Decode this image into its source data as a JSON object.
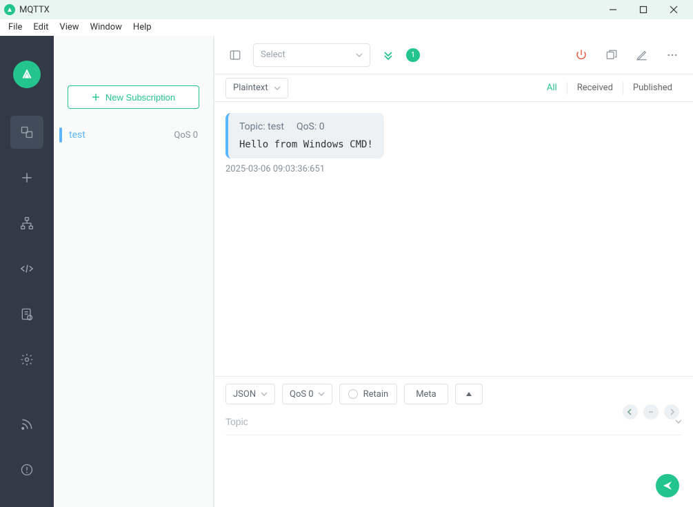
{
  "window": {
    "title": "MQTTX"
  },
  "menubar": {
    "file": "File",
    "edit": "Edit",
    "view": "View",
    "window": "Window",
    "help": "Help"
  },
  "sidebar": {
    "items": [
      "connections",
      "new",
      "tree",
      "code",
      "log",
      "settings",
      "feed",
      "info"
    ]
  },
  "subs": {
    "new_label": "New Subscription",
    "items": [
      {
        "name": "test",
        "qos": "QoS 0"
      }
    ]
  },
  "topbar": {
    "select_placeholder": "Select",
    "badge_count": "1"
  },
  "filter": {
    "format": "Plaintext",
    "tabs": {
      "all": "All",
      "received": "Received",
      "published": "Published"
    }
  },
  "messages": [
    {
      "topic_label": "Topic: ",
      "topic": "test",
      "qos_label": "QoS: ",
      "qos": "0",
      "body": "Hello from Windows CMD!",
      "time": "2025-03-06 09:03:36:651"
    }
  ],
  "publish": {
    "payload_fmt": "JSON",
    "qos": "QoS 0",
    "retain": "Retain",
    "meta": "Meta",
    "topic_placeholder": "Topic"
  }
}
